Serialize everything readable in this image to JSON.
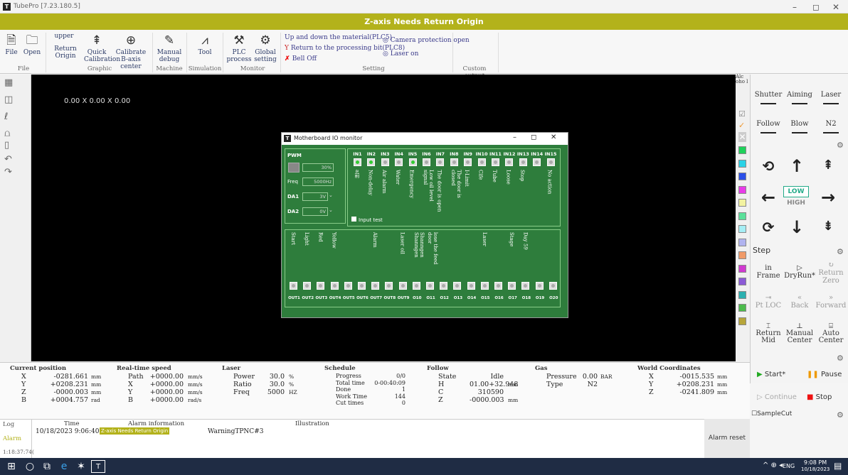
{
  "window": {
    "title": "TubePro [7.23.180.5]",
    "minimize": "–",
    "maximize": "◻",
    "close": "✕"
  },
  "banner": "Z-axis Needs Return Origin",
  "ribbon": {
    "file": {
      "new_label": "File",
      "open_label": "Open",
      "group": "File"
    },
    "graphic": {
      "upper": "upper",
      "return_origin": "Return Origin",
      "quick_calibration": "Quick Calibration",
      "calibrate_b": "Calibrate B-axis center",
      "group": "Graphic"
    },
    "machine": {
      "manual_debug": "Manual debug",
      "group": "Machine"
    },
    "simulation": {
      "tool": "Tool",
      "group": "Simulation"
    },
    "monitor": {
      "plc_process": "PLC process",
      "global_setting": "Global setting",
      "group": "Monitor"
    },
    "setting": {
      "item1": "Up and down the material(PLC5)",
      "item2": "Return to the processing bit(PLC8)",
      "item3": "Bell Off",
      "item4": "Camera protection open",
      "item5": "Laser on",
      "group": "Setting"
    },
    "custom_output": "Custom output"
  },
  "canvas": {
    "dims": "0.00 X 0.00 X 0.00"
  },
  "right_panel": {
    "shutter": "Shutter",
    "aiming": "Aiming",
    "laser": "Laser",
    "follow": "Follow",
    "blow": "Blow",
    "n2": "N2",
    "low": "LOW",
    "high": "HIGH",
    "step": "Step",
    "in": "in",
    "frame": "Frame",
    "dryrun": "DryRun*",
    "return_zero": "Return Zero",
    "pt_loc": "Pt LOC",
    "back": "Back",
    "forward": "Forward",
    "return_mid": "Return Mid",
    "manual_center": "Manual Center",
    "auto_center": "Auto Center",
    "start": "Start*",
    "pause": "Pause",
    "continue": "Continue",
    "stop": "Stop",
    "samplecut": "SampleCut",
    "alc": "Alc oho l"
  },
  "palette_colors": [
    "#1fd15a",
    "#2ad2e6",
    "#2b4fe8",
    "#e83be8",
    "#f2f2a0",
    "#5ae09a",
    "#a5eef5",
    "#b0b3ef",
    "#f09a68",
    "#d03ad0",
    "#8b5ad6",
    "#2bb0b0",
    "#4cbb4c",
    "#b7a53a"
  ],
  "status": {
    "current_position": {
      "header": "Current position",
      "rows": [
        {
          "axis": "X",
          "value": "-0281.661",
          "unit": "mm"
        },
        {
          "axis": "Y",
          "value": "+0208.231",
          "unit": "mm"
        },
        {
          "axis": "Z",
          "value": "-0000.003",
          "unit": "mm"
        },
        {
          "axis": "B",
          "value": "+0004.757",
          "unit": "rad"
        }
      ]
    },
    "realtime_speed": {
      "header": "Real-time speed",
      "rows": [
        {
          "axis": "Path",
          "value": "+0000.00",
          "unit": "mm/s"
        },
        {
          "axis": "X",
          "value": "+0000.00",
          "unit": "mm/s"
        },
        {
          "axis": "Y",
          "value": "+0000.00",
          "unit": "mm/s"
        },
        {
          "axis": "B",
          "value": "+0000.00",
          "unit": "rad/s"
        }
      ]
    },
    "laser": {
      "header": "Laser",
      "rows": [
        {
          "name": "Power",
          "value": "30.0",
          "unit": "%"
        },
        {
          "name": "Ratio",
          "value": "30.0",
          "unit": "%"
        },
        {
          "name": "Freq",
          "value": "5000",
          "unit": "HZ"
        }
      ]
    },
    "schedule": {
      "header": "Schedule",
      "rows": [
        {
          "name": "Progress",
          "value": "0/0"
        },
        {
          "name": "Total time",
          "value": "0-00:40:09"
        },
        {
          "name": "Done",
          "value": "1"
        },
        {
          "name": "Work Time",
          "value": "144"
        },
        {
          "name": "Cut times",
          "value": "0"
        }
      ]
    },
    "follow": {
      "header": "Follow",
      "rows": [
        {
          "name": "State",
          "value": "Idle",
          "unit": ""
        },
        {
          "name": "H",
          "value": "01.00+32.948",
          "unit": "mm"
        },
        {
          "name": "C",
          "value": "310590",
          "unit": ""
        },
        {
          "name": "Z",
          "value": "-0000.003",
          "unit": "mm"
        }
      ]
    },
    "gas": {
      "header": "Gas",
      "rows": [
        {
          "name": "Pressure",
          "value": "0.00",
          "unit": "BAR"
        },
        {
          "name": "Type",
          "value": "N2",
          "unit": ""
        }
      ]
    },
    "world": {
      "header": "World Coordinates",
      "rows": [
        {
          "axis": "X",
          "value": "-0015.535",
          "unit": "mm"
        },
        {
          "axis": "Y",
          "value": "+0208.231",
          "unit": "mm"
        },
        {
          "axis": "Z",
          "value": "-0241.809",
          "unit": "mm"
        }
      ]
    }
  },
  "log": {
    "tabs": [
      "Log",
      "Alarm",
      "1:18:37:74("
    ],
    "headers": {
      "time": "Time",
      "alarm": "Alarm information",
      "illustration": "Illustration"
    },
    "row": {
      "time": "10/18/2023 9:06:40 P",
      "alarm": "Z-axis Needs Return Origin",
      "illustration": "WarningTPNC#3"
    },
    "alarm_reset": "Alarm reset"
  },
  "dialog": {
    "title": "Motherboard IO monitor",
    "pwm": {
      "label": "PWM",
      "value": "30%",
      "freq_label": "Freq",
      "freq": "5000Hz",
      "da1_label": "DA1",
      "da1": "3V",
      "da2_label": "DA2",
      "da2": "0V"
    },
    "inputs": [
      "IN1",
      "IN2",
      "IN3",
      "IN4",
      "IN5",
      "IN6",
      "IN7",
      "IN8",
      "IN9",
      "IN10",
      "IN11",
      "IN12",
      "IN13",
      "IN14",
      "IN15"
    ],
    "input_states": [
      1,
      1,
      0,
      0,
      1,
      0,
      0,
      0,
      0,
      0,
      0,
      0,
      0,
      0,
      0
    ],
    "input_desc": [
      "a前",
      "Non-delay",
      "Air alarm",
      "Water",
      "Emergency",
      "Low oil level signal",
      "The door is open",
      "The door is closed",
      "I-Limit",
      "Cife",
      "Tube",
      "Loose",
      "Stop",
      "",
      "No action"
    ],
    "input_test": "Input test",
    "outputs": [
      "OUT1",
      "OUT2",
      "OUT3",
      "OUT4",
      "OUT5",
      "OUT6",
      "OUT7",
      "OUT8",
      "OUT9",
      "O10",
      "O11",
      "O12",
      "O13",
      "O14",
      "O15",
      "O16",
      "O17",
      "O18",
      "O19",
      "O20"
    ],
    "output_desc": [
      "Start",
      "Light",
      "Red",
      "Yellow",
      "",
      "",
      "Alarm",
      "",
      "Laser oil",
      "Shanngen Shanngen",
      "lose the feed door",
      "",
      "",
      "",
      "Laser",
      "",
      "Stage",
      "Day 59",
      "",
      ""
    ]
  },
  "taskbar": {
    "lang": "ENG",
    "time": "9:08 PM",
    "date": "10/18/2023"
  }
}
